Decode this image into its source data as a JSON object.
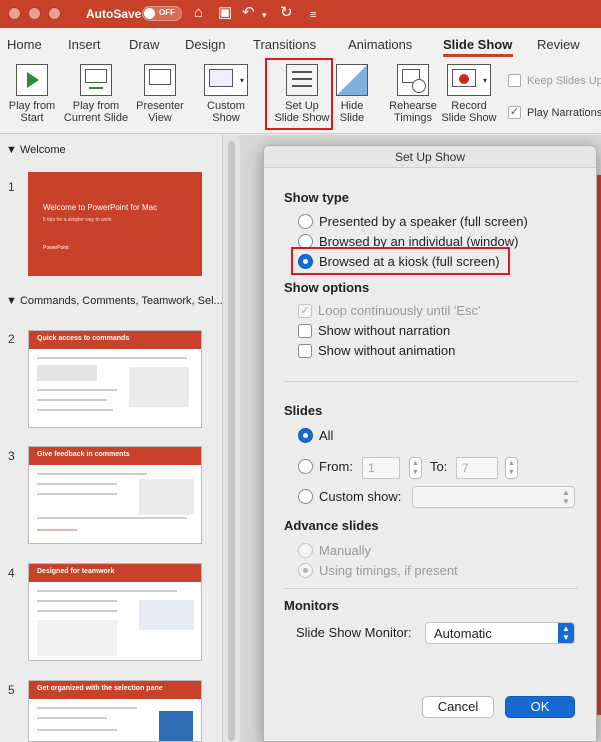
{
  "titlebar": {
    "autosave_label": "AutoSave",
    "autosave_state": "OFF"
  },
  "tabs": [
    "Home",
    "Insert",
    "Draw",
    "Design",
    "Transitions",
    "Animations",
    "Slide Show",
    "Review"
  ],
  "active_tab": "Slide Show",
  "ribbon": {
    "play_from_start": [
      "Play from",
      "Start"
    ],
    "play_current": [
      "Play from",
      "Current Slide"
    ],
    "presenter_view": [
      "Presenter",
      "View"
    ],
    "custom_show": [
      "Custom",
      "Show"
    ],
    "setup_show": [
      "Set Up",
      "Slide Show"
    ],
    "hide_slide": [
      "Hide",
      "Slide"
    ],
    "rehearse": [
      "Rehearse",
      "Timings"
    ],
    "record": [
      "Record",
      "Slide Show"
    ],
    "keep_slides_up": "Keep Slides Up",
    "play_narrations": "Play Narrations"
  },
  "slide_pane": {
    "section1": "Welcome",
    "section2": "Commands, Comments, Teamwork, Sel...",
    "slides": [
      {
        "num": "1",
        "title": "Welcome to PowerPoint for Mac",
        "subtitle": "5 tips for a simpler way to work",
        "brand": "PowerPoint"
      },
      {
        "num": "2",
        "title": "Quick access to commands"
      },
      {
        "num": "3",
        "title": "Give feedback in comments"
      },
      {
        "num": "4",
        "title": "Designed for teamwork"
      },
      {
        "num": "5",
        "title": "Get organized with the selection pane"
      }
    ]
  },
  "dialog": {
    "title": "Set Up Show",
    "show_type": {
      "label": "Show type",
      "options": [
        "Presented by a speaker (full screen)",
        "Browsed by an individual (window)",
        "Browsed at a kiosk (full screen)"
      ],
      "selected": "Browsed at a kiosk (full screen)"
    },
    "show_options": {
      "label": "Show options",
      "loop": "Loop continuously until 'Esc'",
      "without_narration": "Show without narration",
      "without_animation": "Show without animation"
    },
    "slides": {
      "label": "Slides",
      "all": "All",
      "from": "From:",
      "from_value": "1",
      "to": "To:",
      "to_value": "7",
      "custom_show": "Custom show:"
    },
    "advance": {
      "label": "Advance slides",
      "manually": "Manually",
      "timings": "Using timings, if present"
    },
    "monitors": {
      "label": "Monitors",
      "monitor_label": "Slide Show Monitor:",
      "monitor_value": "Automatic"
    },
    "cancel": "Cancel",
    "ok": "OK"
  }
}
